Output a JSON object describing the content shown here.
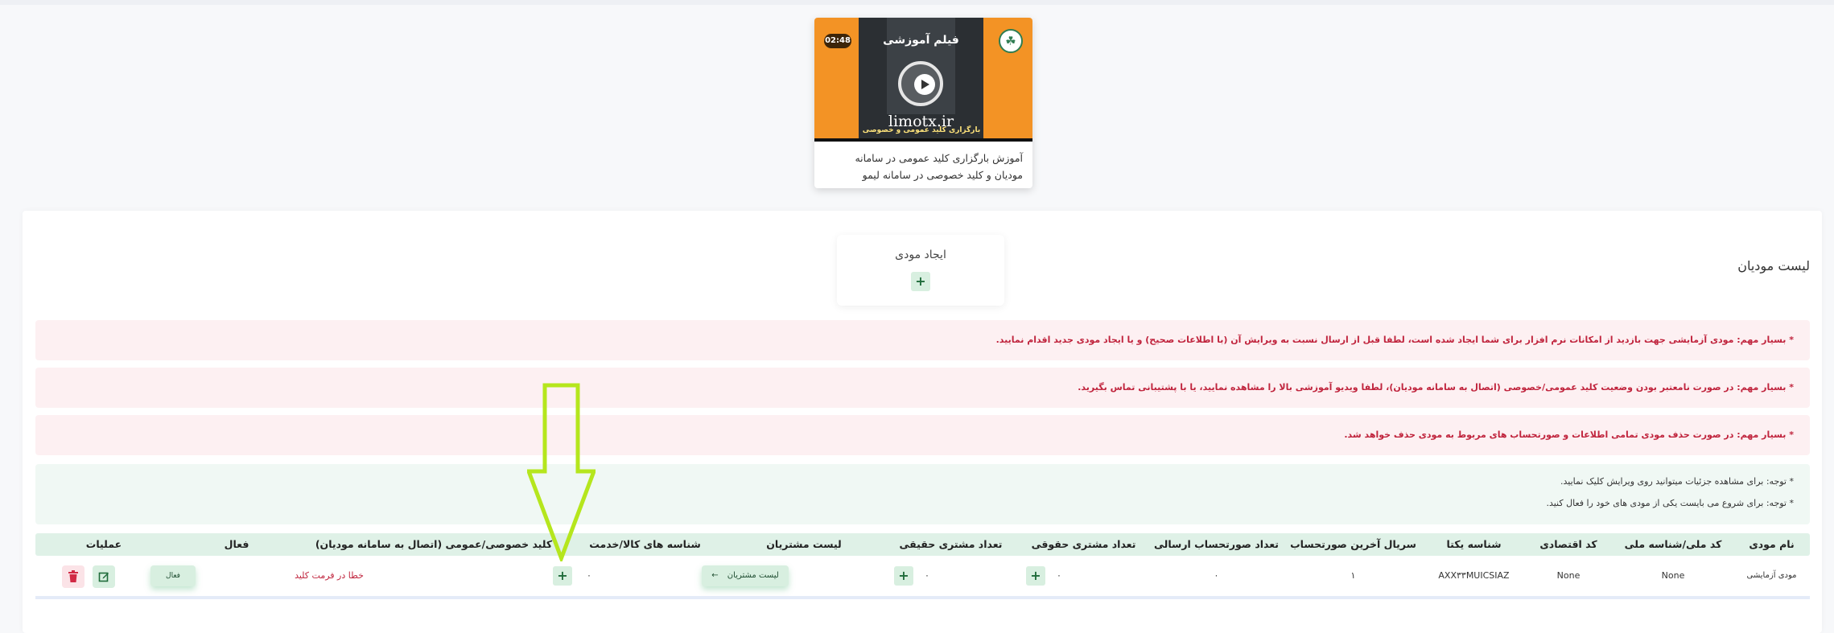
{
  "video": {
    "duration": "02:48",
    "thumb_title": "فیلم آموزشی",
    "thumb_domain": "limotx.ir",
    "thumb_band": "بارگزاری کلید عمومی و خصوصی در سامانه مودیان",
    "description": "آموزش بارگزاری کلید عمومی در سامانه مودیان و کلید خصوصی در سامانه لیمو"
  },
  "page": {
    "title": "لیست مودیان"
  },
  "create": {
    "label": "ایجاد مودی",
    "plus": "+"
  },
  "alerts": [
    "* بسیار مهم: مودی آزمایشی جهت بازدید از امکانات نرم افزار برای شما ایجاد شده است، لطفا قبل از ارسال نسبت به ویرایش آن (با اطلاعات صحیح) و یا ایجاد مودی جدید اقدام نمایید.",
    "* بسیار مهم: در صورت نامعتبر بودن وضعیت کلید عمومی/خصوصی (اتصال به سامانه مودیان)، لطفا ویدیو آموزشی بالا را مشاهده نمایید، یا با پشتیبانی تماس بگیرید.",
    "* بسیار مهم: در صورت حذف مودی تمامی اطلاعات و صورتحساب های مربوط به مودی حذف خواهد شد."
  ],
  "notes": [
    "* توجه: برای مشاهده جزئیات میتوانید روی ویرایش کلیک نمایید.",
    "* توجه: برای شروع می بایست یکی از مودی های خود را فعال کنید."
  ],
  "table": {
    "headers": {
      "name": "نام مودی",
      "national_id": "کد ملی/شناسه ملی",
      "economic_code": "کد اقتصادی",
      "unique_id": "شناسه یکتا",
      "last_serial": "سریال آخرین صورتحساب",
      "sent_count": "تعداد صورتحساب ارسالی",
      "legal_count": "تعداد مشتری حقوقی",
      "real_count": "تعداد مشتری حقیقی",
      "customers": "لیست مشتریان",
      "product_ids": "شناسه های کالا/خدمت",
      "keys": "کلید خصوصی/عمومی (اتصال به سامانه مودیان)",
      "active": "فعال",
      "actions": "عملیات"
    },
    "rows": [
      {
        "name": "مودی آزمایشی",
        "national_id": "None",
        "economic_code": "None",
        "unique_id": "AXX۳۳MUICSIAZ",
        "last_serial": "۱",
        "sent_count": "۰",
        "legal_count": "۰",
        "real_count": "۰",
        "customers_label": "لیست مشتریان",
        "customers_arrow": "←",
        "product_ids": "۰",
        "keys_status": "خطا در فرمت کلید",
        "active_label": "فعال"
      }
    ]
  },
  "colors": {
    "accent_green": "#d8efe0",
    "danger": "#c0243d",
    "annotation_arrow": "#b5e61d"
  }
}
